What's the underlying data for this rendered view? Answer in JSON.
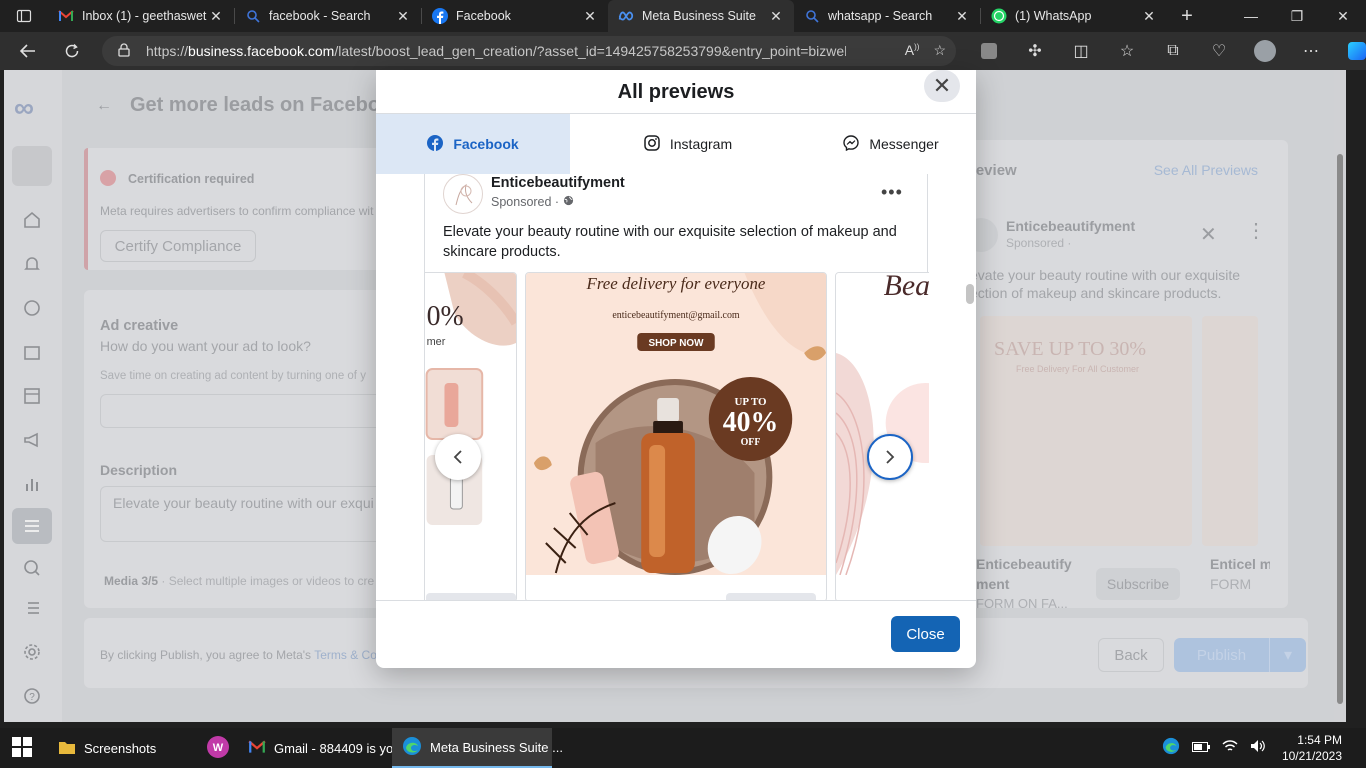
{
  "browser": {
    "tabs": [
      {
        "title": "Inbox (1) - geethaswet",
        "icon": "gmail-icon"
      },
      {
        "title": "facebook - Search",
        "icon": "search-icon"
      },
      {
        "title": "Facebook",
        "icon": "facebook-icon"
      },
      {
        "title": "Meta Business Suite",
        "icon": "meta-icon",
        "active": true
      },
      {
        "title": "whatsapp - Search",
        "icon": "search-icon"
      },
      {
        "title": "(1) WhatsApp",
        "icon": "whatsapp-icon"
      }
    ],
    "url_prefix": "https://",
    "url_host": "business.facebook.com",
    "url_path": "/latest/boost_lead_gen_creation/?asset_id=149425758253799&entry_point=bizweb_..."
  },
  "page": {
    "header_title": "Get more leads on Facebo",
    "certification": {
      "title": "Certification required",
      "text": "Meta requires advertisers to confirm compliance wit",
      "button": "Certify Compliance"
    },
    "ad_creative": {
      "title": "Ad creative",
      "subtitle": "How do you want your ad to look?",
      "help": "Save time on creating ad content by turning one of y",
      "description_label": "Description",
      "description_value": "Elevate your beauty routine with our exqui",
      "media_label": "Media 3/5",
      "media_help": " · Select multiple images or videos to cre"
    },
    "footer": {
      "text": "By clicking Publish, you agree to Meta's ",
      "terms_link": "Terms & Co",
      "back": "Back",
      "publish": "Publish"
    },
    "preview": {
      "title": "review",
      "see_all": "See All Previews",
      "page_name": "Enticebeautifyment",
      "sponsored": "Sponsored · ",
      "text": "evate your beauty routine with our exquisite ection of makeup and skincare products.",
      "save_text": "SAVE UP TO 30%",
      "save_sub": "Free Delivery For All Customer",
      "caption1": "Enticebeautify ment",
      "caption1_sub": "FORM ON FA...",
      "subscribe": "Subscribe",
      "caption2": "Enticel ment",
      "caption2_sub": "FORM"
    }
  },
  "modal": {
    "title": "All previews",
    "tabs": [
      {
        "label": "Facebook",
        "icon": "facebook-icon",
        "active": true
      },
      {
        "label": "Instagram",
        "icon": "instagram-icon"
      },
      {
        "label": "Messenger",
        "icon": "messenger-icon"
      }
    ],
    "post": {
      "page_name": "Enticebeautifyment",
      "sponsored": "Sponsored ·",
      "text": "Elevate your beauty routine with our exquisite selection of makeup and skincare products.",
      "slide_main": {
        "headline": "Free delivery for everyone",
        "email": "enticebeautifyment@gmail.com",
        "cta": "SHOP NOW",
        "badge_top": "UP TO",
        "badge_pct": "40%",
        "badge_bottom": "OFF"
      },
      "slide_prev_text": "0%",
      "slide_prev_sub": "mer",
      "slide_next_text": "Bea"
    },
    "close": "Close"
  },
  "taskbar": {
    "items": [
      {
        "label": "Screenshots",
        "icon": "folder-icon"
      },
      {
        "label": "",
        "icon": "app-icon"
      },
      {
        "label": "Gmail - 884409 is yo...",
        "icon": "gmail-icon"
      },
      {
        "label": "Meta Business Suite ...",
        "icon": "edge-icon",
        "active": true
      }
    ],
    "time": "1:54 PM",
    "date": "10/21/2023"
  },
  "colors": {
    "facebook_blue": "#1b64c5",
    "close_button": "#1464b4"
  }
}
